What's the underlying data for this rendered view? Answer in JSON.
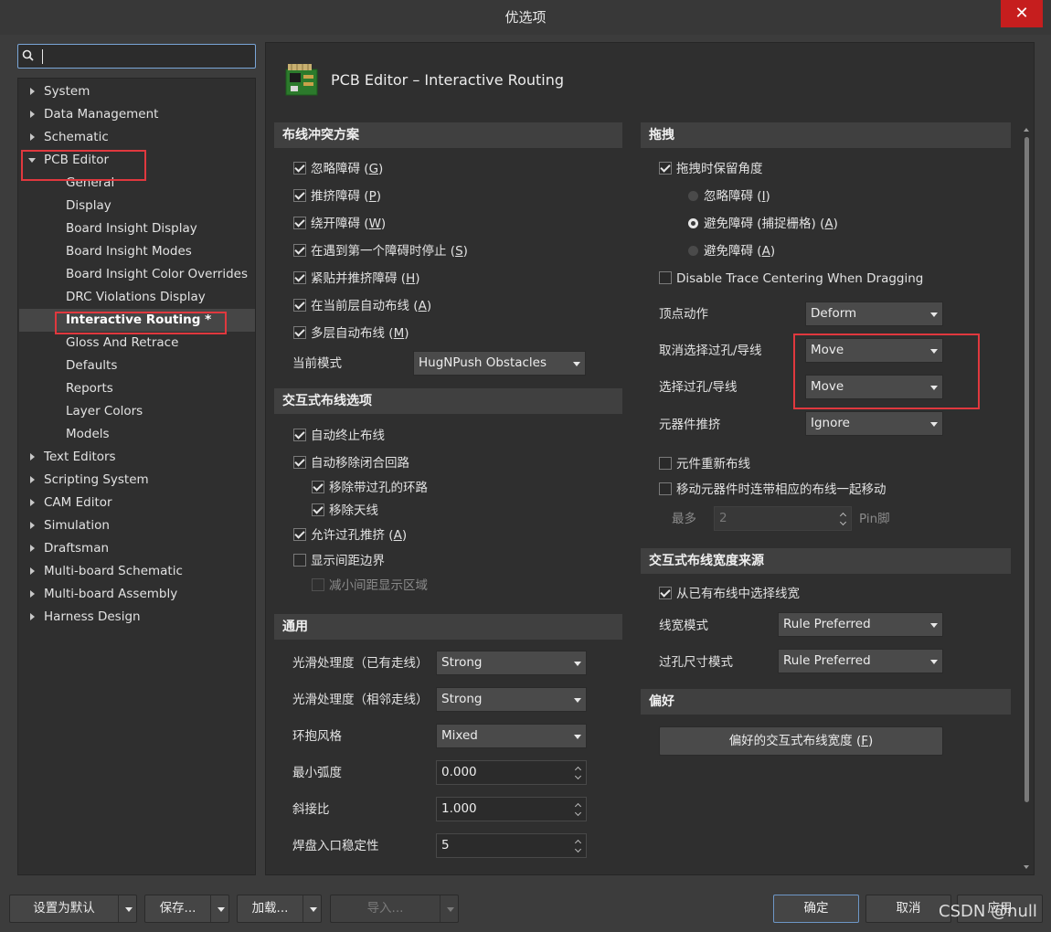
{
  "window": {
    "title": "优选项",
    "close_glyph": "✕"
  },
  "search": {
    "placeholder": ""
  },
  "tree": {
    "items": [
      {
        "label": "System",
        "expandable": true
      },
      {
        "label": "Data Management",
        "expandable": true
      },
      {
        "label": "Schematic",
        "expandable": true
      },
      {
        "label": "PCB Editor",
        "expanded": true
      },
      {
        "label": "General"
      },
      {
        "label": "Display"
      },
      {
        "label": "Board Insight Display"
      },
      {
        "label": "Board Insight Modes"
      },
      {
        "label": "Board Insight Color Overrides"
      },
      {
        "label": "DRC Violations Display"
      },
      {
        "label": "Interactive Routing *",
        "selected": true
      },
      {
        "label": "Gloss And Retrace"
      },
      {
        "label": "Defaults"
      },
      {
        "label": "Reports"
      },
      {
        "label": "Layer Colors"
      },
      {
        "label": "Models"
      },
      {
        "label": "Text Editors",
        "expandable": true
      },
      {
        "label": "Scripting System",
        "expandable": true
      },
      {
        "label": "CAM Editor",
        "expandable": true
      },
      {
        "label": "Simulation",
        "expandable": true
      },
      {
        "label": "Draftsman",
        "expandable": true
      },
      {
        "label": "Multi-board Schematic",
        "expandable": true
      },
      {
        "label": "Multi-board Assembly",
        "expandable": true
      },
      {
        "label": "Harness Design",
        "expandable": true
      }
    ]
  },
  "page": {
    "title": "PCB Editor – Interactive Routing",
    "icon": "pcb-board-icon"
  },
  "conflict": {
    "title": "布线冲突方案",
    "options": [
      {
        "label": "忽略障碍",
        "key": "G",
        "checked": true
      },
      {
        "label": "推挤障碍",
        "key": "P",
        "checked": true
      },
      {
        "label": "绕开障碍",
        "key": "W",
        "checked": true
      },
      {
        "label": "在遇到第一个障碍时停止",
        "key": "S",
        "checked": true
      },
      {
        "label": "紧贴并推挤障碍",
        "key": "H",
        "checked": true
      },
      {
        "label": "在当前层自动布线",
        "key": "A",
        "checked": true
      },
      {
        "label": "多层自动布线",
        "key": "M",
        "checked": true
      }
    ],
    "mode_label": "当前模式",
    "mode_value": "HugNPush Obstacles"
  },
  "interactive": {
    "title": "交互式布线选项",
    "auto_terminate": "自动终止布线",
    "auto_remove_loops": "自动移除闭合回路",
    "remove_via_loops": "移除带过孔的环路",
    "remove_antenna": "移除天线",
    "allow_via_push": "允许过孔推挤",
    "allow_via_push_key": "A",
    "show_clearance": "显示间距边界",
    "reduce_clearance": "减小间距显示区域"
  },
  "general": {
    "title": "通用",
    "rows": [
      {
        "label": "光滑处理度（已有走线）",
        "value": "Strong",
        "kind": "dropdown"
      },
      {
        "label": "光滑处理度（相邻走线）",
        "value": "Strong",
        "kind": "dropdown"
      },
      {
        "label": "环抱风格",
        "value": "Mixed",
        "kind": "dropdown"
      },
      {
        "label": "最小弧度",
        "value": "0.000",
        "kind": "spin"
      },
      {
        "label": "斜接比",
        "value": "1.000",
        "kind": "spin"
      },
      {
        "label": "焊盘入口稳定性",
        "value": "5",
        "kind": "spin"
      }
    ]
  },
  "drag": {
    "title": "拖拽",
    "keep_angle": "拖拽时保留角度",
    "radios": [
      {
        "label": "忽略障碍",
        "suffix": " (",
        "key": "I",
        "end": ")",
        "selected": false
      },
      {
        "label": "避免障碍 (捕捉栅格)",
        "suffix": " (",
        "key": "A",
        "end": ")",
        "selected": true
      },
      {
        "label": "避免障碍",
        "suffix": " (",
        "key": "A",
        "end": ")",
        "selected": false
      }
    ],
    "disable_centering": "Disable Trace Centering When Dragging",
    "vertex_label": "顶点动作",
    "vertex_value": "Deform",
    "unselected_label": "取消选择过孔/导线",
    "unselected_value": "Move",
    "selected_label": "选择过孔/导线",
    "selected_value": "Move",
    "comp_push_label": "元器件推挤",
    "comp_push_value": "Ignore",
    "comp_reroute": "元件重新布线",
    "move_with_comp": "移动元器件时连带相应的布线一起移动",
    "max_label": "最多",
    "max_value": "2",
    "max_unit": "Pin脚"
  },
  "width_source": {
    "title": "交互式布线宽度来源",
    "pick_from_existing": "从已有布线中选择线宽",
    "width_mode_label": "线宽模式",
    "width_mode_value": "Rule Preferred",
    "via_mode_label": "过孔尺寸模式",
    "via_mode_value": "Rule Preferred"
  },
  "preferences": {
    "title": "偏好",
    "button_label": "偏好的交互式布线宽度",
    "button_key": "F"
  },
  "footer": {
    "set_default": "设置为默认",
    "save": "保存...",
    "load": "加载...",
    "import": "导入...",
    "ok": "确定",
    "cancel": "取消",
    "apply": "应用"
  },
  "watermark": "CSDN @null",
  "colors": {
    "highlight_box": "#e0383e",
    "close_button": "#c61e1e",
    "accent_border": "#7aa6d8"
  }
}
